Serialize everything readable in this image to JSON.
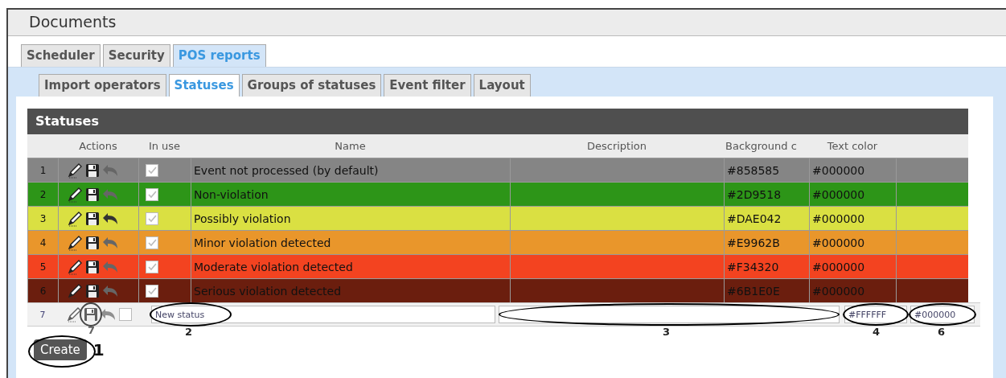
{
  "window": {
    "title": "Documents"
  },
  "tabs": [
    {
      "label": "Scheduler",
      "selected": false
    },
    {
      "label": "Security",
      "selected": false
    },
    {
      "label": "POS reports",
      "selected": true
    }
  ],
  "subtabs": [
    {
      "label": "Import operators",
      "selected": false
    },
    {
      "label": "Statuses",
      "selected": true
    },
    {
      "label": "Groups of statuses",
      "selected": false
    },
    {
      "label": "Event filter",
      "selected": false
    },
    {
      "label": "Layout",
      "selected": false
    }
  ],
  "table": {
    "title": "Statuses",
    "columns": [
      "Actions",
      "In use",
      "Name",
      "Description",
      "Background c",
      "Text color"
    ],
    "rows": [
      {
        "number": "1",
        "in_use": true,
        "name": "Event not processed (by default)",
        "background": "#858585",
        "text_color": "#000000",
        "color": "#858585"
      },
      {
        "number": "2",
        "in_use": true,
        "name": "Non-violation",
        "background": "#2D9518",
        "text_color": "#000000",
        "color": "#2d9518"
      },
      {
        "number": "3",
        "in_use": true,
        "name": "Possibly violation",
        "background": "#DAE042",
        "text_color": "#000000",
        "color": "#dae042"
      },
      {
        "number": "4",
        "in_use": true,
        "name": "Minor violation detected",
        "background": "#E9962B",
        "text_color": "#000000",
        "color": "#e9962b"
      },
      {
        "number": "5",
        "in_use": true,
        "name": "Moderate violation detected",
        "background": "#F34320",
        "text_color": "#000000",
        "color": "#f34320"
      },
      {
        "number": "6",
        "in_use": true,
        "name": "Serious violation detected",
        "background": "#6B1E0E",
        "text_color": "#000000",
        "color": "#6b1e0e"
      }
    ],
    "new_row": {
      "number": "7",
      "in_use": false,
      "save_callout": "7",
      "name": {
        "value": "New status",
        "callout": "2"
      },
      "description": {
        "callout": "3"
      },
      "background": {
        "value": "#FFFFFF",
        "callout": "4"
      },
      "text_color": {
        "value": "#000000",
        "callout": "6"
      }
    }
  },
  "create_button": {
    "label": "Create",
    "callout": "1"
  }
}
